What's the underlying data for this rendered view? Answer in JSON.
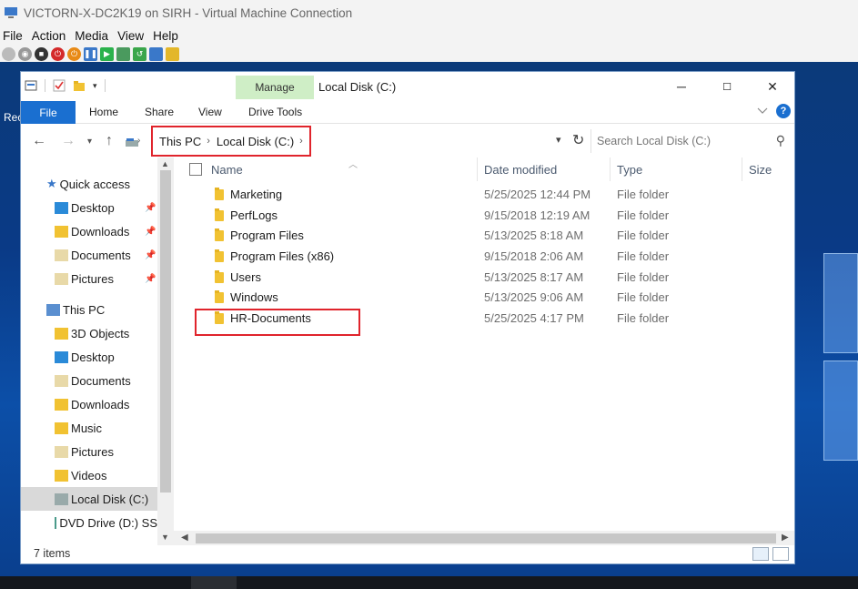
{
  "vm": {
    "title": "VICTORN-X-DC2K19 on SIRH - Virtual Machine Connection",
    "menu": [
      "File",
      "Action",
      "Media",
      "View",
      "Help"
    ]
  },
  "desktop": {
    "label": "Rec"
  },
  "explorer": {
    "manage_tab": "Manage",
    "window_title": "Local Disk (C:)",
    "minimize_glyph": "─",
    "maximize_glyph": "☐",
    "close_glyph": "✕",
    "ribbon": {
      "file": "File",
      "tabs": [
        "Home",
        "Share",
        "View",
        "Drive Tools"
      ],
      "help": "?"
    },
    "address": {
      "crumbs": [
        "This PC",
        "Local Disk (C:)"
      ],
      "search_placeholder": "Search Local Disk (C:)"
    },
    "nav": {
      "quick_access": "Quick access",
      "quick_items": [
        "Desktop",
        "Downloads",
        "Documents",
        "Pictures"
      ],
      "this_pc": "This PC",
      "pc_items": [
        "3D Objects",
        "Desktop",
        "Documents",
        "Downloads",
        "Music",
        "Pictures",
        "Videos",
        "Local Disk (C:)",
        "DVD Drive (D:) SS"
      ]
    },
    "columns": {
      "name": "Name",
      "date": "Date modified",
      "type": "Type",
      "size": "Size"
    },
    "files": [
      {
        "name": "Marketing",
        "date": "5/25/2025 12:44 PM",
        "type": "File folder"
      },
      {
        "name": "PerfLogs",
        "date": "9/15/2018 12:19 AM",
        "type": "File folder"
      },
      {
        "name": "Program Files",
        "date": "5/13/2025 8:18 AM",
        "type": "File folder"
      },
      {
        "name": "Program Files (x86)",
        "date": "9/15/2018 2:06 AM",
        "type": "File folder"
      },
      {
        "name": "Users",
        "date": "5/13/2025 8:17 AM",
        "type": "File folder"
      },
      {
        "name": "Windows",
        "date": "5/13/2025 9:06 AM",
        "type": "File folder"
      },
      {
        "name": "HR-Documents",
        "date": "5/25/2025 4:17 PM",
        "type": "File folder"
      }
    ],
    "status": "7 items",
    "colors": {
      "accent": "#1a6fd0",
      "highlight": "#e0242c",
      "manage": "#cfeec6",
      "folder": "#f1c232"
    }
  }
}
